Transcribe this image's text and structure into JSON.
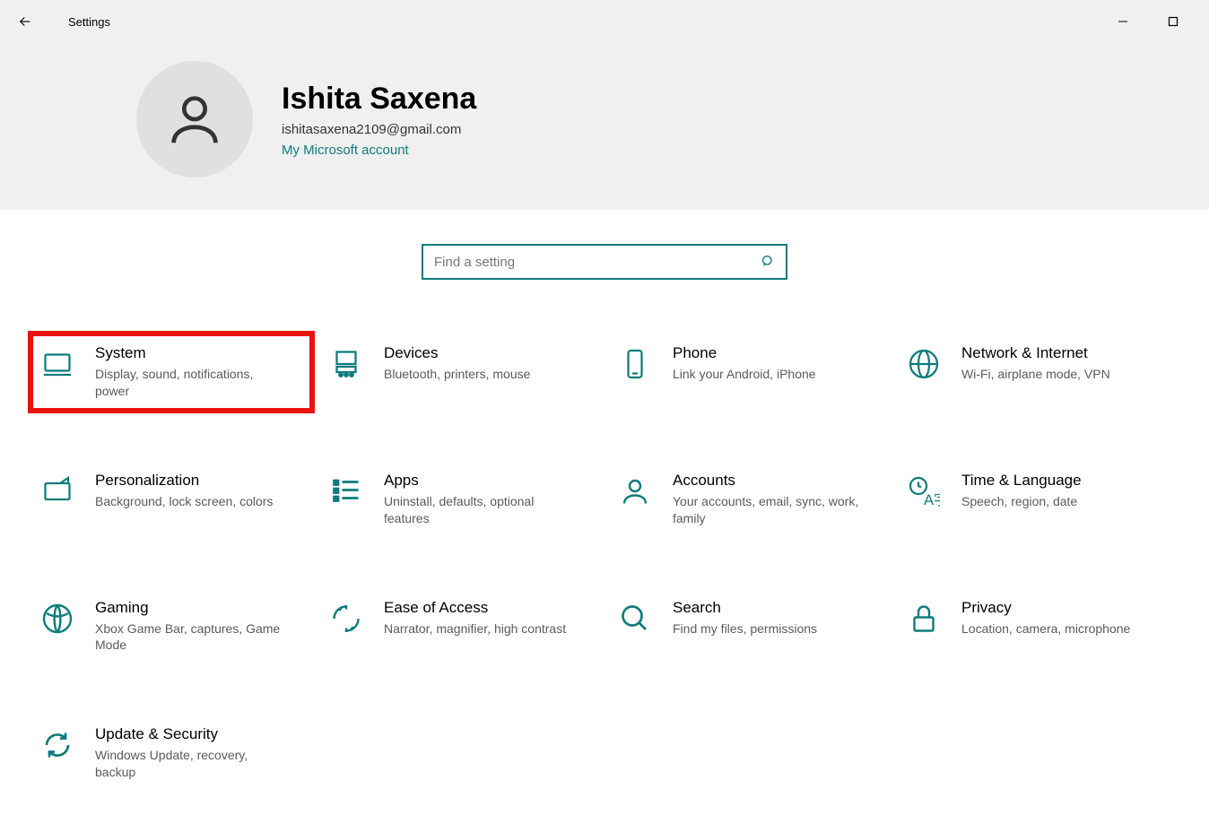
{
  "window": {
    "title": "Settings"
  },
  "user": {
    "name": "Ishita Saxena",
    "email": "ishitasaxena2109@gmail.com",
    "accountLink": "My Microsoft account"
  },
  "search": {
    "placeholder": "Find a setting"
  },
  "colors": {
    "accent": "#0f7b7b",
    "highlight": "#e8130e"
  },
  "tiles": [
    {
      "id": "system",
      "title": "System",
      "desc": "Display, sound, notifications, power",
      "highlighted": true
    },
    {
      "id": "devices",
      "title": "Devices",
      "desc": "Bluetooth, printers, mouse",
      "highlighted": false
    },
    {
      "id": "phone",
      "title": "Phone",
      "desc": "Link your Android, iPhone",
      "highlighted": false
    },
    {
      "id": "network",
      "title": "Network & Internet",
      "desc": "Wi-Fi, airplane mode, VPN",
      "highlighted": false
    },
    {
      "id": "personalization",
      "title": "Personalization",
      "desc": "Background, lock screen, colors",
      "highlighted": false
    },
    {
      "id": "apps",
      "title": "Apps",
      "desc": "Uninstall, defaults, optional features",
      "highlighted": false
    },
    {
      "id": "accounts",
      "title": "Accounts",
      "desc": "Your accounts, email, sync, work, family",
      "highlighted": false
    },
    {
      "id": "timelang",
      "title": "Time & Language",
      "desc": "Speech, region, date",
      "highlighted": false
    },
    {
      "id": "gaming",
      "title": "Gaming",
      "desc": "Xbox Game Bar, captures, Game Mode",
      "highlighted": false
    },
    {
      "id": "ease",
      "title": "Ease of Access",
      "desc": "Narrator, magnifier, high contrast",
      "highlighted": false
    },
    {
      "id": "search",
      "title": "Search",
      "desc": "Find my files, permissions",
      "highlighted": false
    },
    {
      "id": "privacy",
      "title": "Privacy",
      "desc": "Location, camera, microphone",
      "highlighted": false
    },
    {
      "id": "update",
      "title": "Update & Security",
      "desc": "Windows Update, recovery, backup",
      "highlighted": false
    }
  ]
}
